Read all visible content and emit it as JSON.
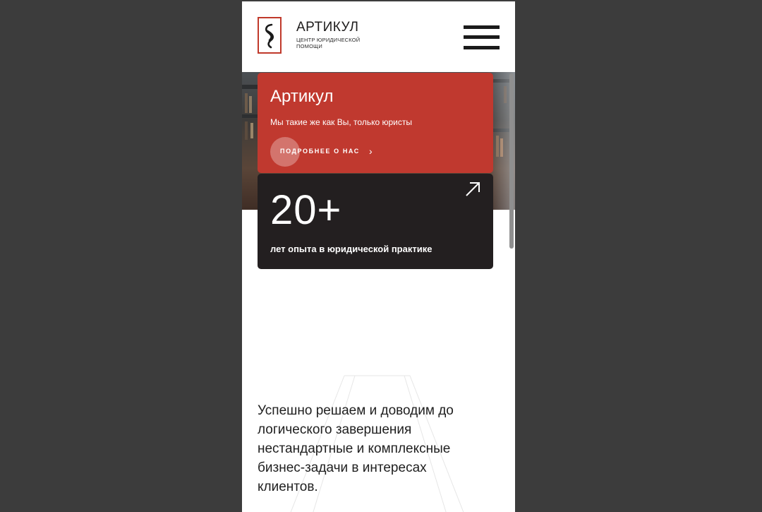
{
  "header": {
    "brand_name": "АРТИКУЛ",
    "brand_subtitle": "ЦЕНТР ЮРИДИЧЕСКОЙ ПОМОЩИ",
    "logo_icon": "section-sign-logo",
    "menu_icon": "hamburger-menu-icon"
  },
  "hero_card": {
    "title": "Артикул",
    "subtitle": "Мы такие же как Вы, только юристы",
    "more_label": "ПОДРОБНЕЕ О НАС",
    "more_arrow": "›"
  },
  "stat_card": {
    "value": "20+",
    "caption": "лет опыта в юридической практике",
    "arrow_icon": "arrow-up-right-icon"
  },
  "description": "Успешно решаем и доводим до логического завершения нестандартные и комплексные бизнес-задачи в интересах клиентов.",
  "colors": {
    "accent_red": "#c0392f",
    "dark_card": "#231f20",
    "outer_background": "#3c3c3c"
  }
}
